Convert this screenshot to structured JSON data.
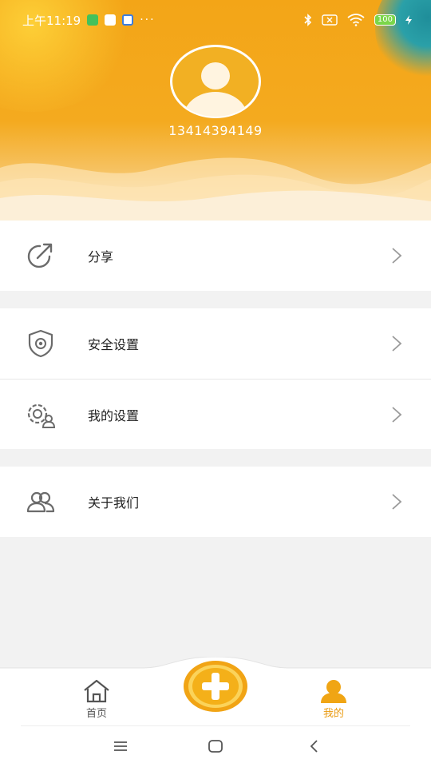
{
  "status_bar": {
    "time": "上午11:19",
    "dots": "···",
    "battery": "100"
  },
  "profile": {
    "phone": "13414394149"
  },
  "menu": {
    "share": "分享",
    "security": "安全设置",
    "my_settings": "我的设置",
    "about": "关于我们"
  },
  "bottom_nav": {
    "home": "首页",
    "mine": "我的"
  },
  "colors": {
    "accent": "#f4a71c",
    "active_tab": "#e99a10",
    "inactive_tab": "#555555"
  }
}
